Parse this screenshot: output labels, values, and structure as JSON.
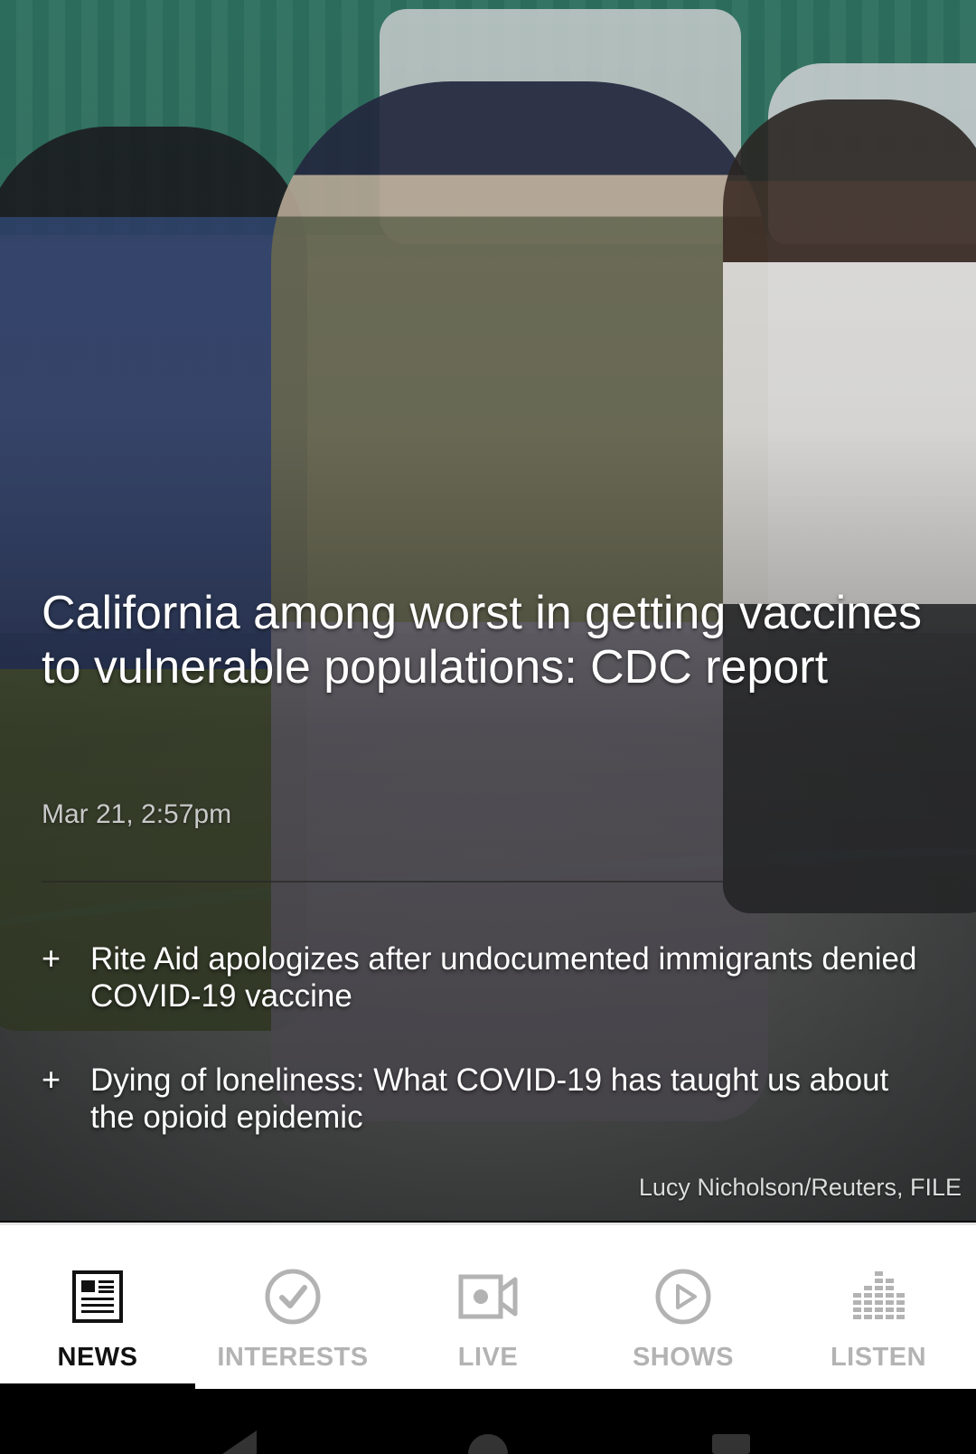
{
  "article": {
    "headline": "California among worst in getting vaccines to vulnerable populations: CDC report",
    "timestamp": "Mar 21, 2:57pm",
    "photo_credit": "Lucy Nicholson/Reuters, FILE"
  },
  "related": [
    {
      "text": "Rite Aid apologizes after undocumented immigrants denied COVID-19 vaccine",
      "icon": "plus-icon",
      "glyph": "+"
    },
    {
      "text": "Dying of loneliness: What COVID-19 has taught us about the opioid epidemic",
      "icon": "plus-icon",
      "glyph": "+"
    }
  ],
  "tabs": [
    {
      "label": "NEWS",
      "icon": "newspaper-icon",
      "active": true
    },
    {
      "label": "INTERESTS",
      "icon": "checkmark-circle-icon",
      "active": false
    },
    {
      "label": "LIVE",
      "icon": "video-camera-icon",
      "active": false
    },
    {
      "label": "SHOWS",
      "icon": "play-circle-icon",
      "active": false
    },
    {
      "label": "LISTEN",
      "icon": "equalizer-icon",
      "active": false
    }
  ],
  "colors": {
    "active_tab": "#111111",
    "inactive_tab": "#b3b3b3",
    "tabbar_bg": "#ffffff"
  }
}
